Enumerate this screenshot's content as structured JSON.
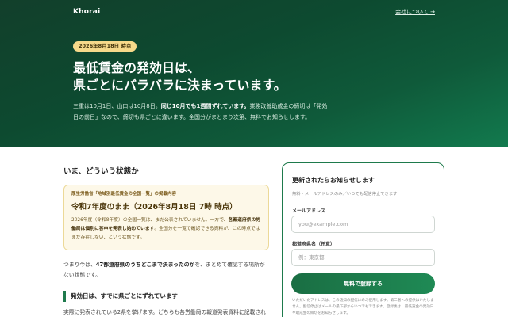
{
  "brand": {
    "logo": "Khorai",
    "about_link": "会社について →"
  },
  "hero": {
    "date_badge": "2026年8月18日 時点",
    "title_line1": "最低賃金の発効日は、",
    "title_line2": "県ごとにバラバラに決まっています。",
    "desc_part1": "三重は10月1日、山口は10月8日。",
    "desc_bold": "同じ10月でも1週間ずれています。",
    "desc_part2": "業務改善助成金の締切は「発効",
    "desc_line2": "日の前日」なので、締切も県ごとに違います。全国分がまとまり次第、無料でお知らせします。"
  },
  "main": {
    "section_title": "いま、どういう状態か",
    "notice": {
      "source": "厚生労働省「地域別最低賃金の全国一覧」の掲載内容",
      "headline": "令和7年度のまま（2026年8月18日 7時 時点）",
      "body_part1": "2026年度（令和8年度）の全国一覧は、まだ公表されていません。一方で、",
      "body_bold": "各都道府県の労働局は個別に答申を発表し始めています",
      "body_part2": "。全国分を一覧で確認できる資料が、この時点ではまだ存在しない、という状態です。"
    },
    "para_part1": "つまり今は、",
    "para_bold": "47都道府県のうちどこまで決まったのか",
    "para_part2": "を、まとめて確認する場所がない状態です。",
    "h3": "発効日は、すでに県ごとにずれています",
    "para2": "実際に発表されている2県を挙げます。どちらも各労働局の報道発表資料に記載され"
  },
  "signup": {
    "title": "更新されたらお知らせします",
    "subtitle": "無料・メールアドレスのみ／いつでも配信停止できます",
    "email_label": "メールアドレス",
    "email_placeholder": "you@example.com",
    "pref_label": "都道府県名（任意）",
    "pref_placeholder": "例：東京都",
    "submit_label": "無料で登録する",
    "disclaimer": "いただいたアドレスは、この通知の配信にのみ使用します。第三者への提供はいたしません。配信停止はメールの最下部からいつでもできます。登録後は、最低賃金の発効日や助成金の締切をお知らせします。"
  },
  "colors": {
    "accent": "#1e7a4c",
    "hero_bg": "#0f4d33",
    "badge": "#f6d98a"
  }
}
